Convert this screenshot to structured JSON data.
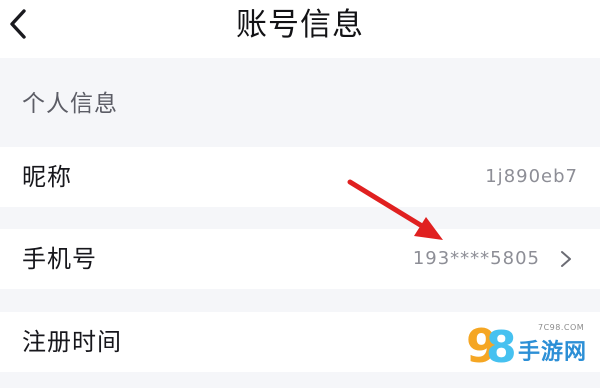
{
  "header": {
    "title": "账号信息",
    "back_icon": "chevron-left-icon"
  },
  "section": {
    "label": "个人信息"
  },
  "rows": [
    {
      "label": "昵称",
      "value": "1j890eb7"
    },
    {
      "label": "手机号",
      "value": "193****5805",
      "icon": "chevron-right-icon"
    },
    {
      "label": "注册时间"
    }
  ],
  "annotation": {
    "color": "#e02020",
    "icon": "red-arrow-icon"
  },
  "watermark": {
    "digit_nine": "9",
    "digit_eight": "8",
    "domain": "7C98.COM",
    "site_name": "手游网",
    "nine_color": "#f5a623",
    "eight_color": "#46c1f0",
    "name_color": "#2c8fd6"
  }
}
